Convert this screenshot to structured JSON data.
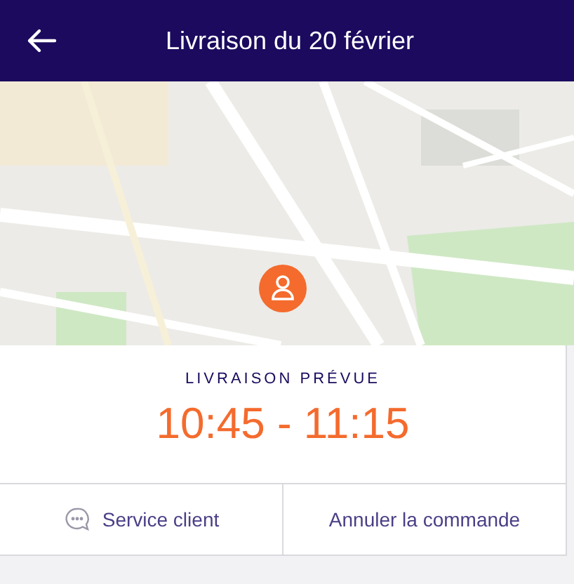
{
  "header": {
    "title": "Livraison du 20 février"
  },
  "delivery": {
    "label": "LIVRAISON PRÉVUE",
    "time_window": "10:45 - 11:15"
  },
  "actions": [
    {
      "label": "Service client",
      "kind": "chat"
    },
    {
      "label": "Annuler la commande",
      "kind": "plain"
    }
  ]
}
